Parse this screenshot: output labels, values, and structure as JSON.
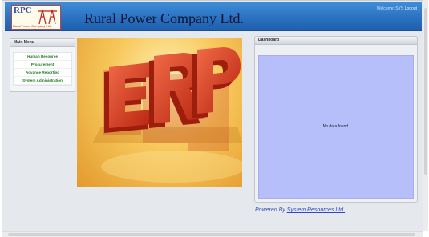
{
  "header": {
    "logo_text": "RPC",
    "logo_subtitle": "Rural Power Company Ltd.",
    "title": "Rural Power Company Ltd.",
    "welcome": "Welcome: SYS",
    "logout": "Logout"
  },
  "menu": {
    "title": "Main Menu",
    "items": [
      {
        "label": "Human Resource"
      },
      {
        "label": "Procurement"
      },
      {
        "label": "Advance Reporting"
      },
      {
        "label": "System Administration"
      }
    ]
  },
  "banner": {
    "text": "ERP"
  },
  "dashboard": {
    "title": "Dashboard",
    "empty_message": "No data found."
  },
  "footer": {
    "prefix": "Powered By",
    "link": "System Resources Ltd."
  },
  "colors": {
    "header": "#2a6fc0",
    "menu_text": "#1d7a1d",
    "dashboard_body": "#b7bffb",
    "erp_red": "#d43b22"
  }
}
